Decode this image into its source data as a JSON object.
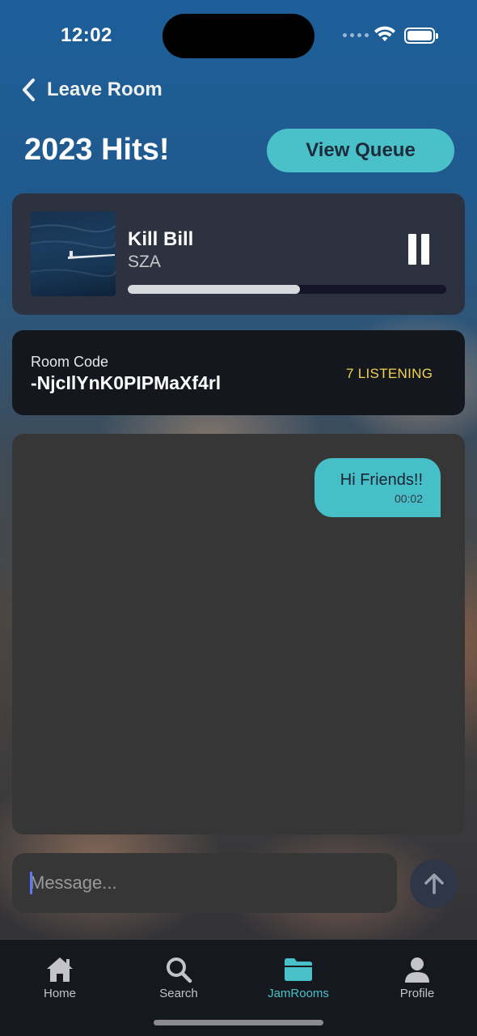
{
  "status_bar": {
    "time": "12:02"
  },
  "header": {
    "back_label": "Leave Room",
    "room_title": "2023 Hits!",
    "view_queue_label": "View Queue"
  },
  "now_playing": {
    "title": "Kill Bill",
    "artist": "SZA",
    "progress": 0.54
  },
  "room_code": {
    "label": "Room Code",
    "value": "-NjcIlYnK0PIPMaXf4rl",
    "listening": "7 LISTENING"
  },
  "chat": {
    "messages": [
      {
        "text": "Hi Friends!!",
        "time": "00:02"
      }
    ]
  },
  "composer": {
    "placeholder": "Message..."
  },
  "tab_bar": {
    "items": [
      {
        "label": "Home",
        "icon": "house-icon"
      },
      {
        "label": "Search",
        "icon": "magnifier-icon"
      },
      {
        "label": "JamRooms",
        "icon": "folder-icon",
        "active": true
      },
      {
        "label": "Profile",
        "icon": "person-icon"
      }
    ]
  },
  "colors": {
    "accent": "#4ac0c8",
    "listening": "#f2d34a",
    "card": "#2d3240",
    "room_code_card": "#15171f",
    "chat_panel": "#363636"
  }
}
